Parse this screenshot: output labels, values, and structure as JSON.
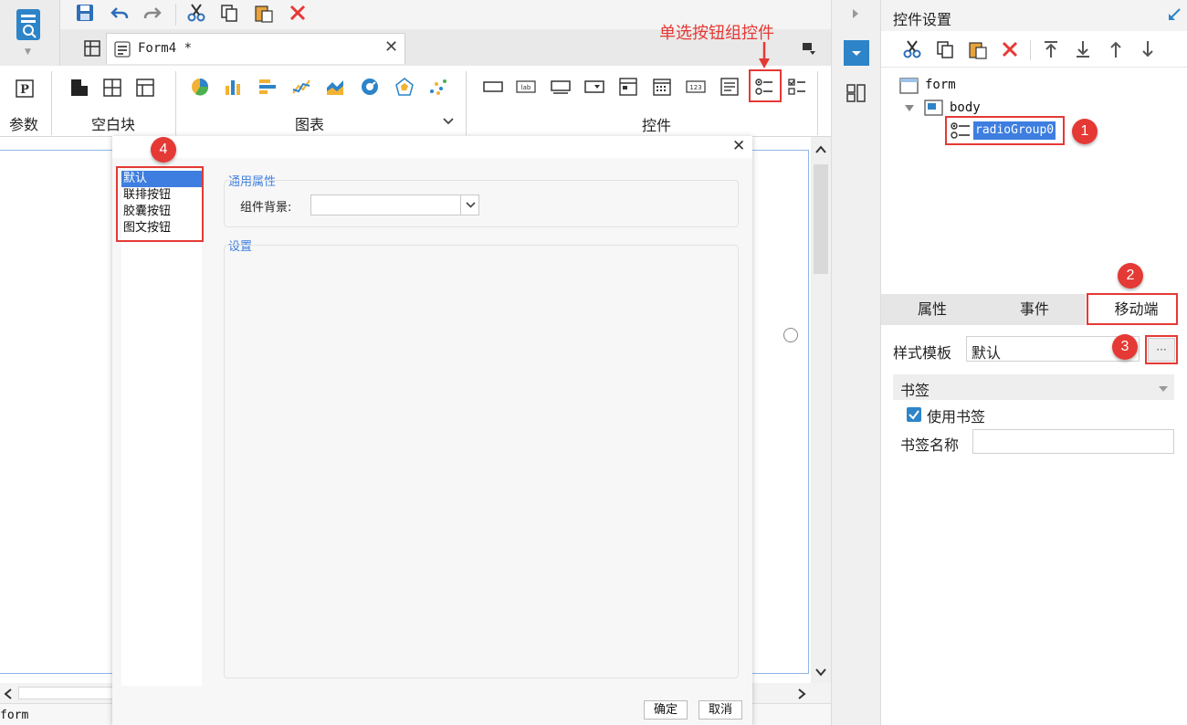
{
  "toolbar": {
    "doc_tab_label": "Form4 *",
    "sections": {
      "param": "参数",
      "blank": "空白块",
      "chart": "图表",
      "widget": "控件"
    }
  },
  "annotations": {
    "radio_group_hint": "单选按钮组控件",
    "badges": [
      "1",
      "2",
      "3",
      "4"
    ]
  },
  "dialog": {
    "templates": [
      "默认",
      "联排按钮",
      "胶囊按钮",
      "图文按钮"
    ],
    "selected_index": 0,
    "general_group_title": "通用属性",
    "bg_label": "组件背景:",
    "bg_value": "",
    "settings_group_title": "设置",
    "ok_label": "确定",
    "cancel_label": "取消"
  },
  "bottom": {
    "form_label": "form"
  },
  "right_panel": {
    "title": "控件设置",
    "tree": {
      "root": "form",
      "body": "body",
      "selected": "radioGroup0"
    },
    "tabs": [
      "属性",
      "事件",
      "移动端"
    ],
    "style_template_label": "样式模板",
    "style_template_value": "默认",
    "more_label": "···",
    "bookmark_section": "书签",
    "use_bookmark_label": "使用书签",
    "use_bookmark_checked": true,
    "bookmark_name_label": "书签名称",
    "bookmark_name_value": ""
  },
  "colors": {
    "accent": "#1e88e5",
    "annotation_red": "#e53935",
    "selection": "#3d7ee0"
  }
}
